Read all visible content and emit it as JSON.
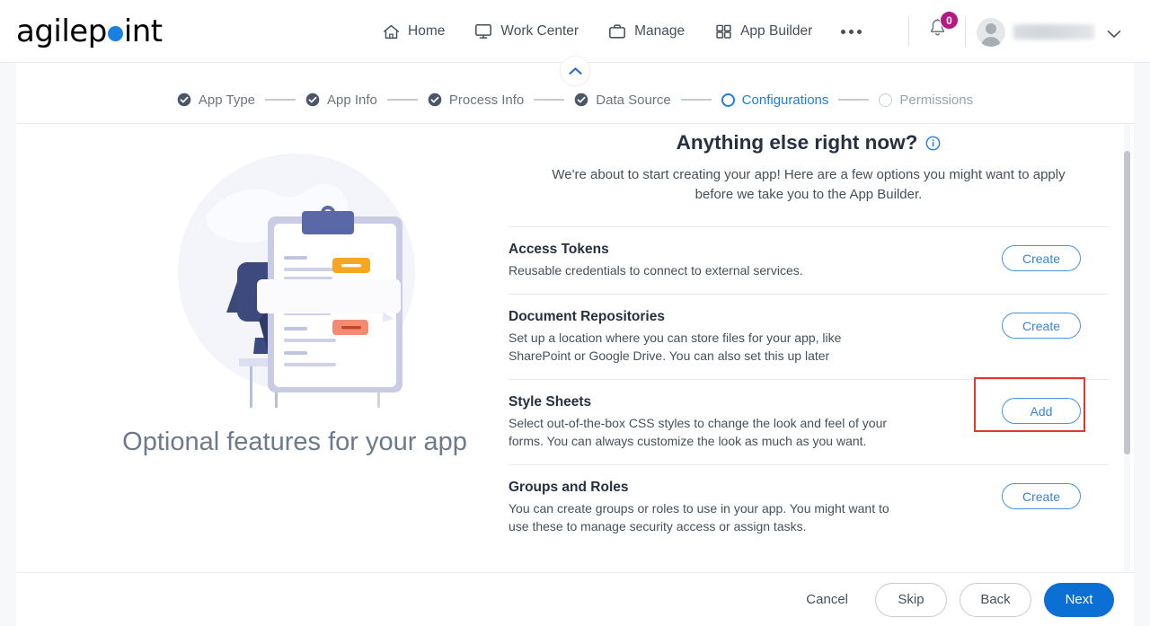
{
  "header": {
    "logo_text_1": "agilep",
    "logo_text_2": "int",
    "nav": [
      {
        "label": "Home",
        "icon": "home-icon"
      },
      {
        "label": "Work Center",
        "icon": "monitor-icon"
      },
      {
        "label": "Manage",
        "icon": "briefcase-icon"
      },
      {
        "label": "App Builder",
        "icon": "grid-icon"
      }
    ],
    "more_label": "More",
    "notification_count": "0",
    "user_name": ""
  },
  "stepper": {
    "steps": [
      {
        "label": "App Type",
        "state": "done"
      },
      {
        "label": "App Info",
        "state": "done"
      },
      {
        "label": "Process Info",
        "state": "done"
      },
      {
        "label": "Data Source",
        "state": "done"
      },
      {
        "label": "Configurations",
        "state": "active"
      },
      {
        "label": "Permissions",
        "state": "todo"
      }
    ]
  },
  "illustration": {
    "caption": "Optional features for your app"
  },
  "main": {
    "title": "Anything else right now?",
    "subtitle": "We're about to start creating your app! Here are a few options you might want to apply before we take you to the App Builder.",
    "options": [
      {
        "title": "Access Tokens",
        "description": "Reusable credentials to connect to external services.",
        "action_label": "Create",
        "highlighted": false
      },
      {
        "title": "Document Repositories",
        "description": "Set up a location where you can store files for your app, like SharePoint or Google Drive. You can also set this up later",
        "action_label": "Create",
        "highlighted": false
      },
      {
        "title": "Style Sheets",
        "description": "Select out-of-the-box CSS styles to change the look and feel of your forms. You can always customize the look as much as you want.",
        "action_label": "Add",
        "highlighted": true
      },
      {
        "title": "Groups and Roles",
        "description": "You can create groups or roles to use in your app. You might want to use these to manage security access or assign tasks.",
        "action_label": "Create",
        "highlighted": false
      }
    ]
  },
  "footer": {
    "cancel_label": "Cancel",
    "skip_label": "Skip",
    "back_label": "Back",
    "next_label": "Next"
  },
  "colors": {
    "accent_blue": "#1a7fe0",
    "primary_button": "#0b6fd4",
    "badge_magenta": "#b5187f",
    "highlight_red": "#d93a33",
    "text_dark": "#263040",
    "text_muted": "#6c757d"
  }
}
